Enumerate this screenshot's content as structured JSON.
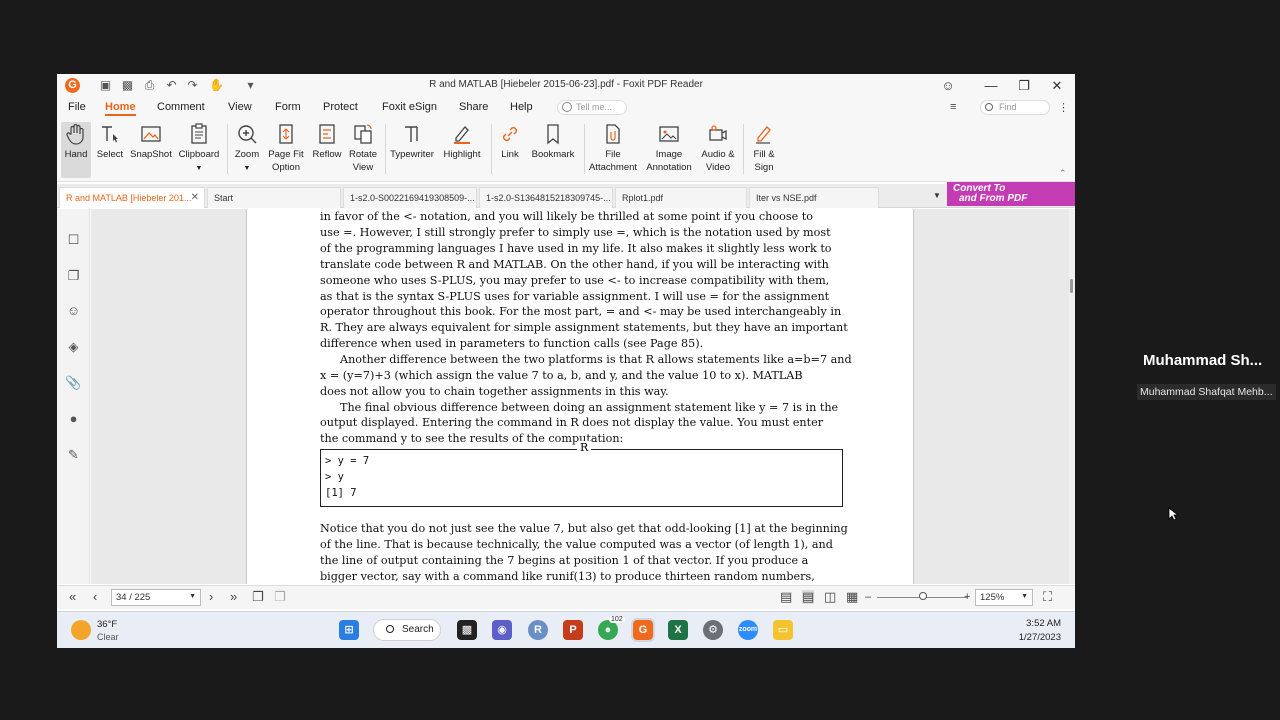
{
  "window": {
    "title": "R and MATLAB [Hiebeler 2015-06-23].pdf - Foxit PDF Reader",
    "app_logo": "G"
  },
  "menu": {
    "items": [
      "File",
      "Home",
      "Comment",
      "View",
      "Form",
      "Protect",
      "Foxit eSign",
      "Share",
      "Help"
    ],
    "active": "Home",
    "tell_me_placeholder": "Tell me...",
    "find_placeholder": "Find"
  },
  "ribbon": {
    "tools": [
      {
        "label": "Hand",
        "icon": "hand-icon"
      },
      {
        "label": "Select",
        "icon": "select-text-icon"
      },
      {
        "label": "SnapShot",
        "icon": "snapshot-icon"
      },
      {
        "label": "Clipboard",
        "icon": "clipboard-icon"
      },
      {
        "label": "Zoom",
        "icon": "zoom-icon"
      },
      {
        "label": "Page Fit Option",
        "icon": "page-fit-icon"
      },
      {
        "label": "Reflow",
        "icon": "reflow-icon"
      },
      {
        "label": "Rotate View",
        "icon": "rotate-icon"
      },
      {
        "label": "Typewriter",
        "icon": "typewriter-icon"
      },
      {
        "label": "Highlight",
        "icon": "highlight-icon"
      },
      {
        "label": "Link",
        "icon": "link-icon"
      },
      {
        "label": "Bookmark",
        "icon": "bookmark-icon"
      },
      {
        "label": "File Attachment",
        "icon": "file-attachment-icon"
      },
      {
        "label": "Image Annotation",
        "icon": "image-annotation-icon"
      },
      {
        "label": "Audio & Video",
        "icon": "audio-video-icon"
      },
      {
        "label": "Fill & Sign",
        "icon": "fill-sign-icon"
      }
    ]
  },
  "tabs": [
    {
      "label": "R and MATLAB [Hiebeler 201...",
      "active": true
    },
    {
      "label": "Start",
      "active": false
    },
    {
      "label": "1-s2.0-S0022169419308509-...",
      "active": false
    },
    {
      "label": "1-s2.0-S1364815218309745-...",
      "active": false
    },
    {
      "label": "Rplot1.pdf",
      "active": false
    },
    {
      "label": "Iter vs NSE.pdf",
      "active": false
    }
  ],
  "convert_banner": {
    "line1": "Convert To",
    "line2": "and From PDF"
  },
  "document": {
    "lines": [
      "in favor of the <- notation, and you will likely be thrilled at some point if you choose to",
      "use =. However, I still strongly prefer to simply use =, which is the notation used by most",
      "of the programming languages I have used in my life. It also makes it slightly less work to",
      "translate code between R and MATLAB. On the other hand, if you will be interacting with",
      "someone who uses S-PLUS, you may prefer to use <- to increase compatibility with them,",
      "as that is the syntax S-PLUS uses for variable assignment. I will use = for the assignment",
      "operator throughout this book. For the most part, = and <- may be used interchangeably in",
      "R. They are always equivalent for simple assignment statements, but they have an important",
      "difference when used in parameters to function calls (see Page 85).",
      "Another difference between the two platforms is that R allows statements like a=b=7 and",
      "x = (y=7)+3 (which assign the value 7 to a, b, and y, and the value 10 to x). MATLAB",
      "does not allow you to chain together assignments in this way.",
      "The final obvious difference between doing an assignment statement like y = 7 is in the",
      "output displayed. Entering the command in R does not display the value. You must enter",
      "the command y to see the results of the computation:"
    ],
    "code_box_label": "R",
    "code_lines": [
      "> y = 7",
      "> y",
      "[1] 7"
    ],
    "after_lines": [
      "Notice that you do not just see the value 7, but also get that odd-looking [1] at the beginning",
      "of the line. That is because technically, the value computed was a vector (of length 1), and",
      "the line of output containing the 7 begins at position 1 of that vector. If you produce a",
      "bigger vector, say with a command like runif(13) to produce thirteen random numbers,"
    ]
  },
  "statusbar": {
    "page_display": "34 / 225",
    "zoom": "125%"
  },
  "taskbar": {
    "temperature": "36°F",
    "condition": "Clear",
    "search_label": "Search",
    "chrome_badge": "102",
    "time": "3:52 AM",
    "date": "1/27/2023"
  },
  "participant": {
    "display_name": "Muhammad  Sh...",
    "full_name": "Muhammad Shafqat Mehb..."
  },
  "colors": {
    "accent": "#e8651b",
    "convert_banner": "#c43cb4"
  }
}
